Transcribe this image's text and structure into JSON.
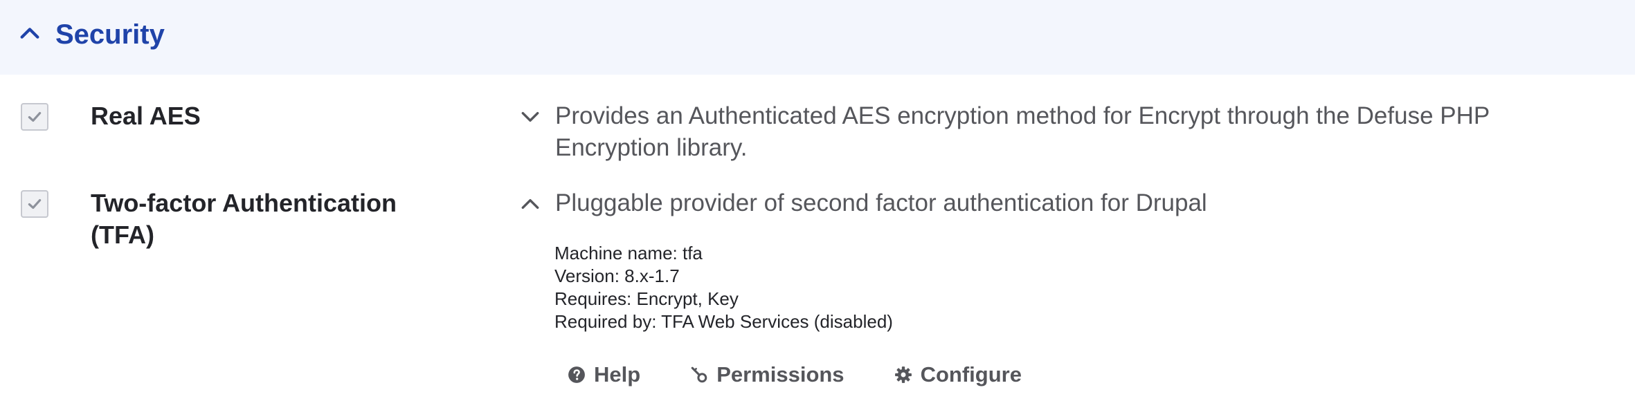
{
  "section": {
    "title": "Security",
    "toggle_icon": "chevron-up-icon",
    "accent_color": "#1f43a9"
  },
  "modules": [
    {
      "name": "Real AES",
      "checked": true,
      "description": "Provides an Authenticated AES encryption method for Encrypt through the Defuse PHP Encryption library.",
      "expanded": false
    },
    {
      "name": "Two-factor Authentication (TFA)",
      "checked": true,
      "description": "Pluggable provider of second factor authentication for Drupal",
      "expanded": true,
      "details": {
        "machine_name": "Machine name: tfa",
        "version": "Version: 8.x-1.7",
        "requires": "Requires: Encrypt, Key",
        "required_by": "Required by: TFA Web Services (disabled)"
      },
      "links": {
        "help": "Help",
        "permissions": "Permissions",
        "configure": "Configure"
      }
    }
  ]
}
